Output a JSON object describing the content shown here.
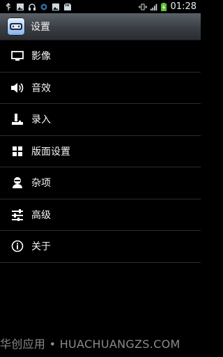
{
  "status_bar": {
    "time": "01:28",
    "left_icons": [
      "usb-icon",
      "image-icon",
      "headset-icon",
      "sync-icon",
      "image-icon",
      "sd-card-icon"
    ],
    "right_icons": [
      "vibrate-icon",
      "signal-icon",
      "battery-charging-icon"
    ]
  },
  "titlebar": {
    "title": "设置",
    "icon": "emulator-app-icon"
  },
  "menu": {
    "items": [
      {
        "label": "影像",
        "icon": "monitor-icon"
      },
      {
        "label": "音效",
        "icon": "speaker-icon"
      },
      {
        "label": "录入",
        "icon": "joystick-icon"
      },
      {
        "label": "版面设置",
        "icon": "grid-icon"
      },
      {
        "label": "杂项",
        "icon": "user-icon"
      },
      {
        "label": "高级",
        "icon": "sliders-icon"
      },
      {
        "label": "关于",
        "icon": "info-icon"
      }
    ]
  },
  "watermark": "华创应用 • HUACHUANGZS.COM",
  "colors": {
    "background": "#000000",
    "titlebar": "#3a3e44",
    "divider": "#2b2b2b",
    "text": "#f4f4f4"
  }
}
